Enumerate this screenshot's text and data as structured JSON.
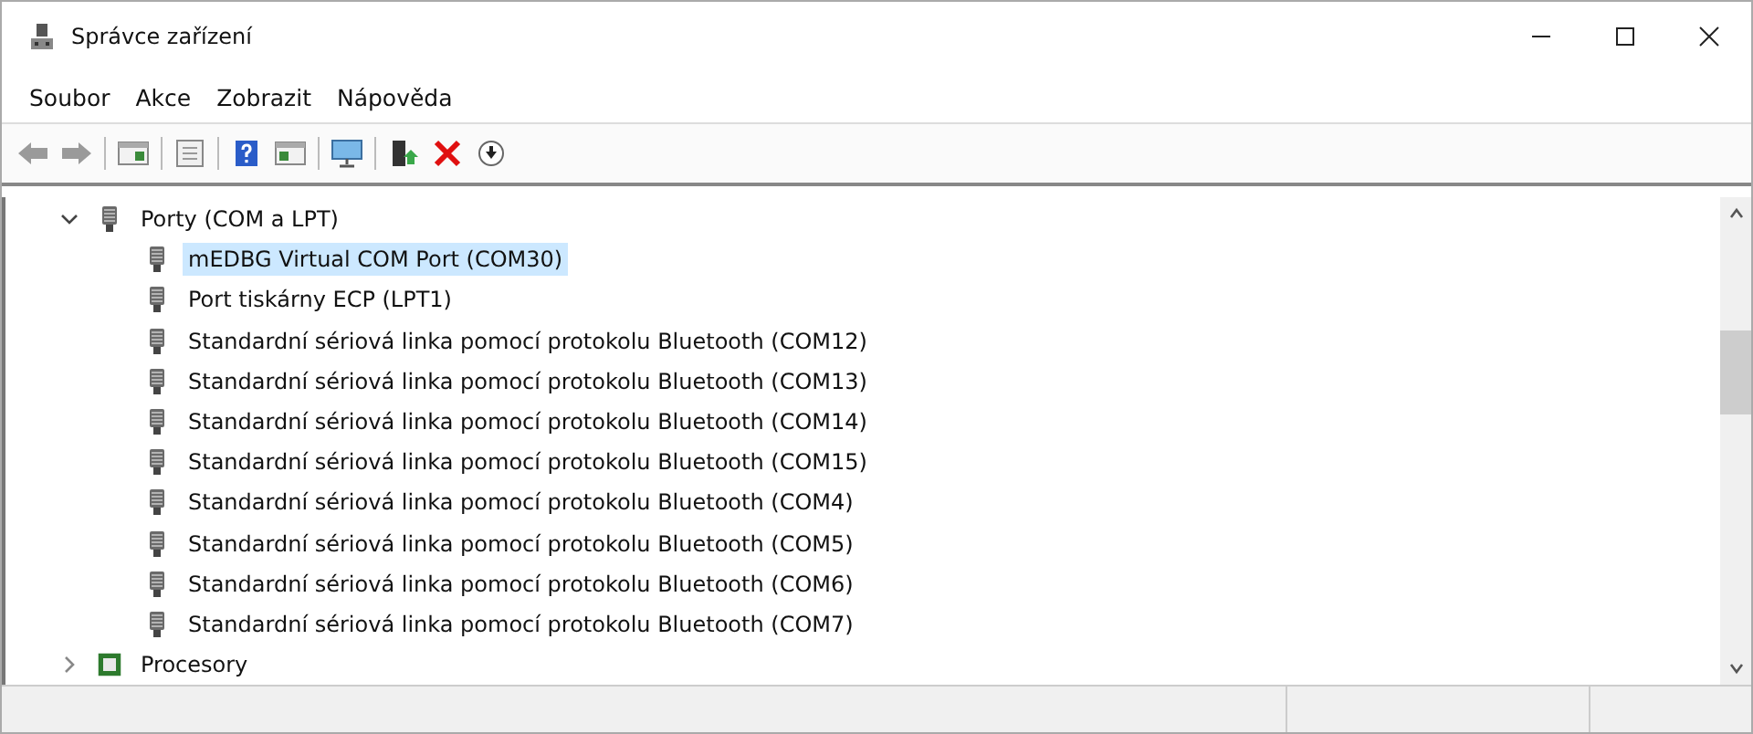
{
  "window": {
    "title": "Správce zařízení"
  },
  "menu": [
    "Soubor",
    "Akce",
    "Zobrazit",
    "Nápověda"
  ],
  "toolbar": [
    {
      "kind": "back"
    },
    {
      "kind": "forward"
    },
    {
      "kind": "sep"
    },
    {
      "kind": "console"
    },
    {
      "kind": "sep"
    },
    {
      "kind": "properties"
    },
    {
      "kind": "sep"
    },
    {
      "kind": "help"
    },
    {
      "kind": "pane"
    },
    {
      "kind": "sep"
    },
    {
      "kind": "monitor"
    },
    {
      "kind": "sep"
    },
    {
      "kind": "update"
    },
    {
      "kind": "remove"
    },
    {
      "kind": "download"
    }
  ],
  "tree": [
    {
      "label": "Porty (COM a LPT)",
      "kind": "port",
      "expanded": true,
      "children": [
        {
          "label": "mEDBG Virtual COM Port (COM30)",
          "selected": true
        },
        {
          "label": "Port tiskárny ECP (LPT1)",
          "selected": false
        },
        {
          "label": "Standardní sériová linka pomocí protokolu Bluetooth (COM12)",
          "selected": false
        },
        {
          "label": "Standardní sériová linka pomocí protokolu Bluetooth (COM13)",
          "selected": false
        },
        {
          "label": "Standardní sériová linka pomocí protokolu Bluetooth (COM14)",
          "selected": false
        },
        {
          "label": "Standardní sériová linka pomocí protokolu Bluetooth (COM15)",
          "selected": false
        },
        {
          "label": "Standardní sériová linka pomocí protokolu Bluetooth (COM4)",
          "selected": false
        },
        {
          "label": "Standardní sériová linka pomocí protokolu Bluetooth (COM5)",
          "selected": false
        },
        {
          "label": "Standardní sériová linka pomocí protokolu Bluetooth (COM6)",
          "selected": false
        },
        {
          "label": "Standardní sériová linka pomocí protokolu Bluetooth (COM7)",
          "selected": false
        }
      ]
    },
    {
      "label": "Procesory",
      "kind": "cpu",
      "expanded": false
    }
  ]
}
